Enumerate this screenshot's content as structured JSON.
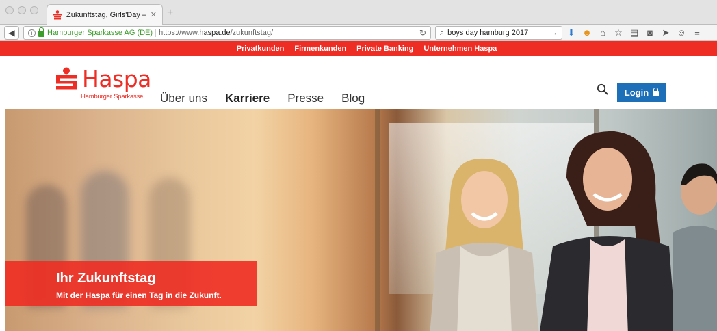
{
  "browser": {
    "tab": {
      "title": "Zukunftstag, Girls'Day – S..."
    },
    "address": {
      "organization": "Hamburger Sparkasse AG (DE)",
      "url_prefix": "https://www.",
      "url_domain": "haspa.de",
      "url_path": "/zukunftstag/"
    },
    "search": {
      "value": "boys day hamburg 2017"
    },
    "toolbar_icons": [
      "download-icon",
      "ghostery-icon",
      "home-icon",
      "bookmark-star-icon",
      "reading-list-icon",
      "pocket-icon",
      "send-icon",
      "chat-icon",
      "menu-icon"
    ]
  },
  "site": {
    "meta_nav": [
      "Privatkunden",
      "Firmenkunden",
      "Private Banking",
      "Unternehmen Haspa"
    ],
    "logo": {
      "brand": "Haspa",
      "subtitle": "Hamburger Sparkasse"
    },
    "main_nav": [
      {
        "label": "Über uns",
        "active": false
      },
      {
        "label": "Karriere",
        "active": true
      },
      {
        "label": "Presse",
        "active": false
      },
      {
        "label": "Blog",
        "active": false
      }
    ],
    "login_label": "Login",
    "hero": {
      "title": "Ihr Zukunftstag",
      "subtitle": "Mit der Haspa für einen Tag in die Zukunft."
    },
    "colors": {
      "brand_red": "#ee2d24",
      "login_blue": "#1d6fb8"
    }
  }
}
